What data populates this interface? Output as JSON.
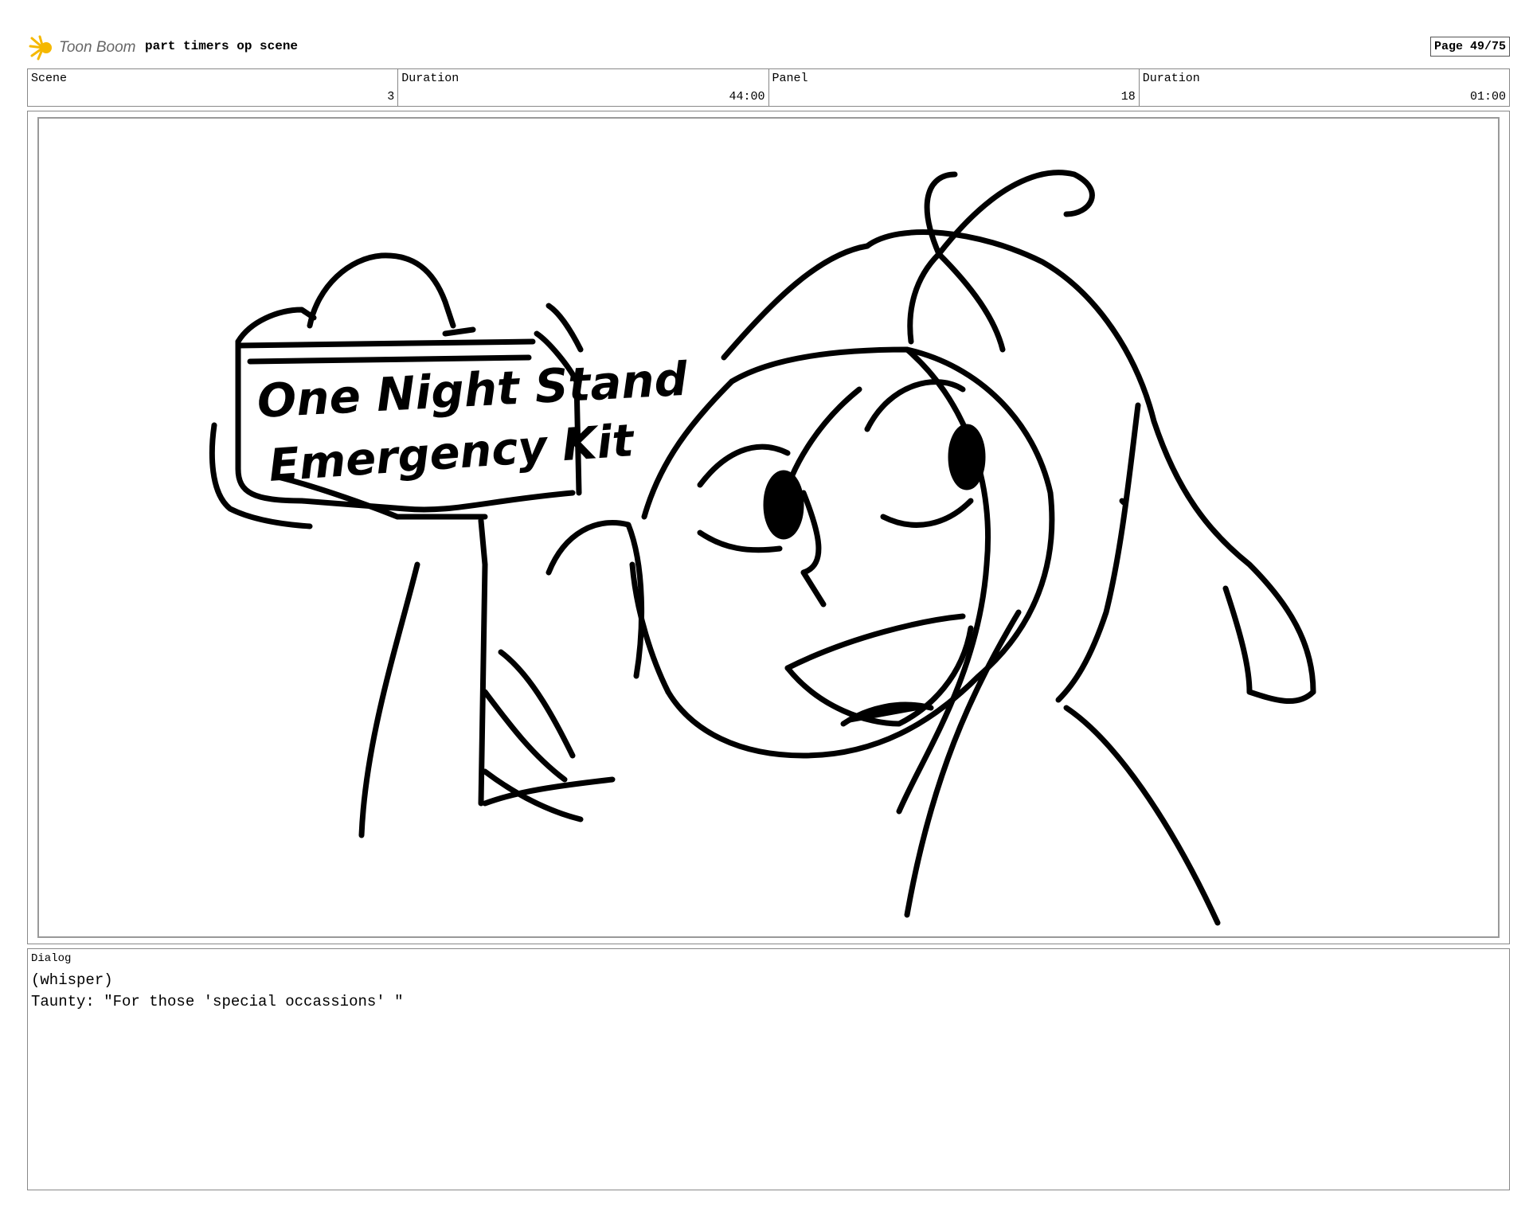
{
  "header": {
    "logo_text": "Toon Boom",
    "project_title": "part timers op scene",
    "page_label": "Page 49/75"
  },
  "info": [
    {
      "label": "Scene",
      "value": "3"
    },
    {
      "label": "Duration",
      "value": "44:00"
    },
    {
      "label": "Panel",
      "value": "18"
    },
    {
      "label": "Duration",
      "value": "01:00"
    }
  ],
  "panel": {
    "box_text_line1": "One Night Stand",
    "box_text_line2": "Emergency Kit"
  },
  "dialog": {
    "label": "Dialog",
    "lines": [
      "(whisper)",
      "Taunty: \"For those 'special occassions' \""
    ]
  },
  "colors": {
    "logo_accent": "#f5b800",
    "ink": "#000000"
  }
}
